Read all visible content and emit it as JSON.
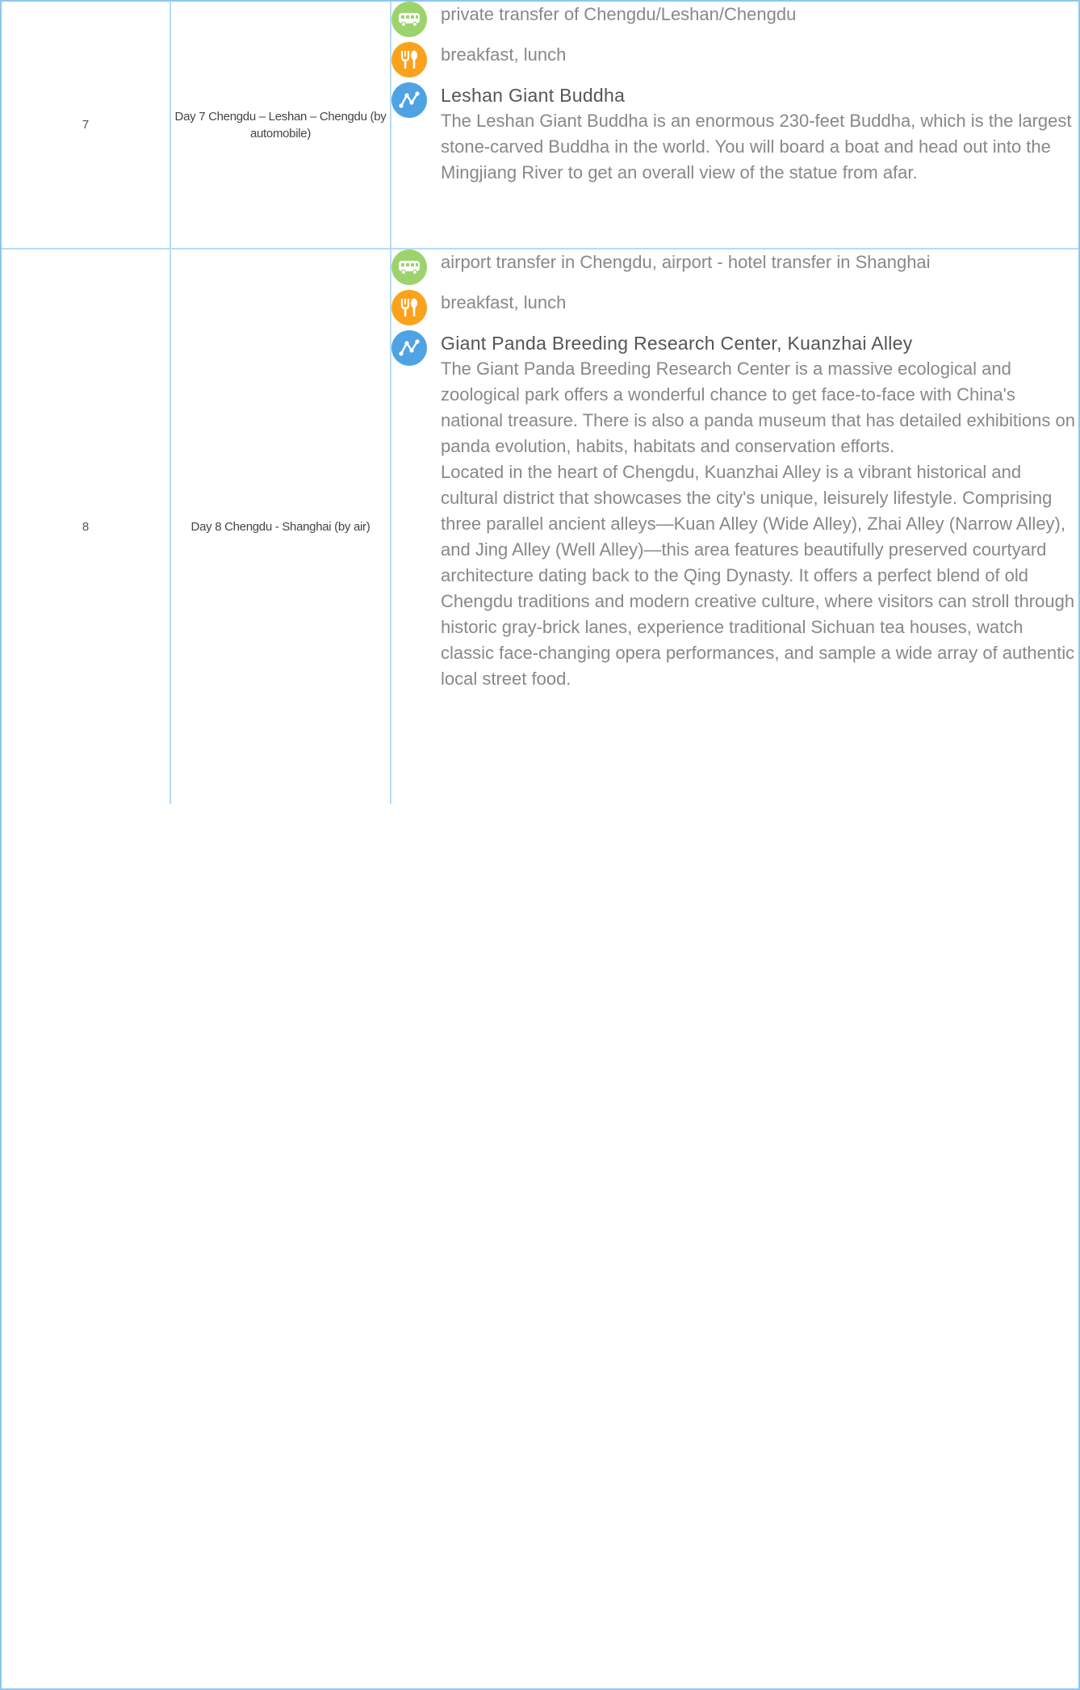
{
  "rows": [
    {
      "number": "7",
      "day": "Day 7 Chengdu – Leshan – Chengdu (by automobile)",
      "transport": "private transfer of Chengdu/Leshan/Chengdu",
      "meals": "breakfast, lunch",
      "spot_title": "Leshan Giant Buddha",
      "spot_desc": [
        "The Leshan Giant Buddha is an enormous 230-feet Buddha, which is the largest stone-carved Buddha in the world. You will board a boat and head out into the Mingjiang River to get an overall view of the statue from afar."
      ]
    },
    {
      "number": "8",
      "day": "Day 8 Chengdu - Shanghai (by air)",
      "transport": "airport transfer in Chengdu, airport - hotel transfer in Shanghai",
      "meals": "breakfast, lunch",
      "spot_title": "Giant Panda Breeding Research Center, Kuanzhai Alley",
      "spot_desc": [
        "The Giant Panda Breeding Research Center is a massive ecological and zoological park offers a wonderful chance to get face-to-face with China's national treasure. There is also a panda museum that has detailed exhibitions on panda evolution, habits, habitats and conservation efforts.",
        "Located in the heart of Chengdu, Kuanzhai Alley is a vibrant historical and cultural district that showcases the city's unique, leisurely lifestyle. Comprising three parallel ancient alleys—Kuan Alley (Wide Alley), Zhai Alley (Narrow Alley), and Jing Alley (Well Alley)—this area features beautifully preserved courtyard architecture dating back to the Qing Dynasty. It offers a perfect blend of old Chengdu traditions and modern creative culture, where visitors can stroll through historic gray-brick lanes, experience traditional Sichuan tea houses, watch classic face-changing opera performances, and sample a wide array of authentic local street food."
      ]
    }
  ],
  "icons": {
    "transport": "bus-icon",
    "meals": "fork-spoon-icon",
    "route": "route-icon"
  },
  "colors": {
    "border": "#b6dcf6",
    "transport_icon": "#9cd36c",
    "meal_icon": "#fba21c",
    "route_icon": "#4fa3e3"
  }
}
